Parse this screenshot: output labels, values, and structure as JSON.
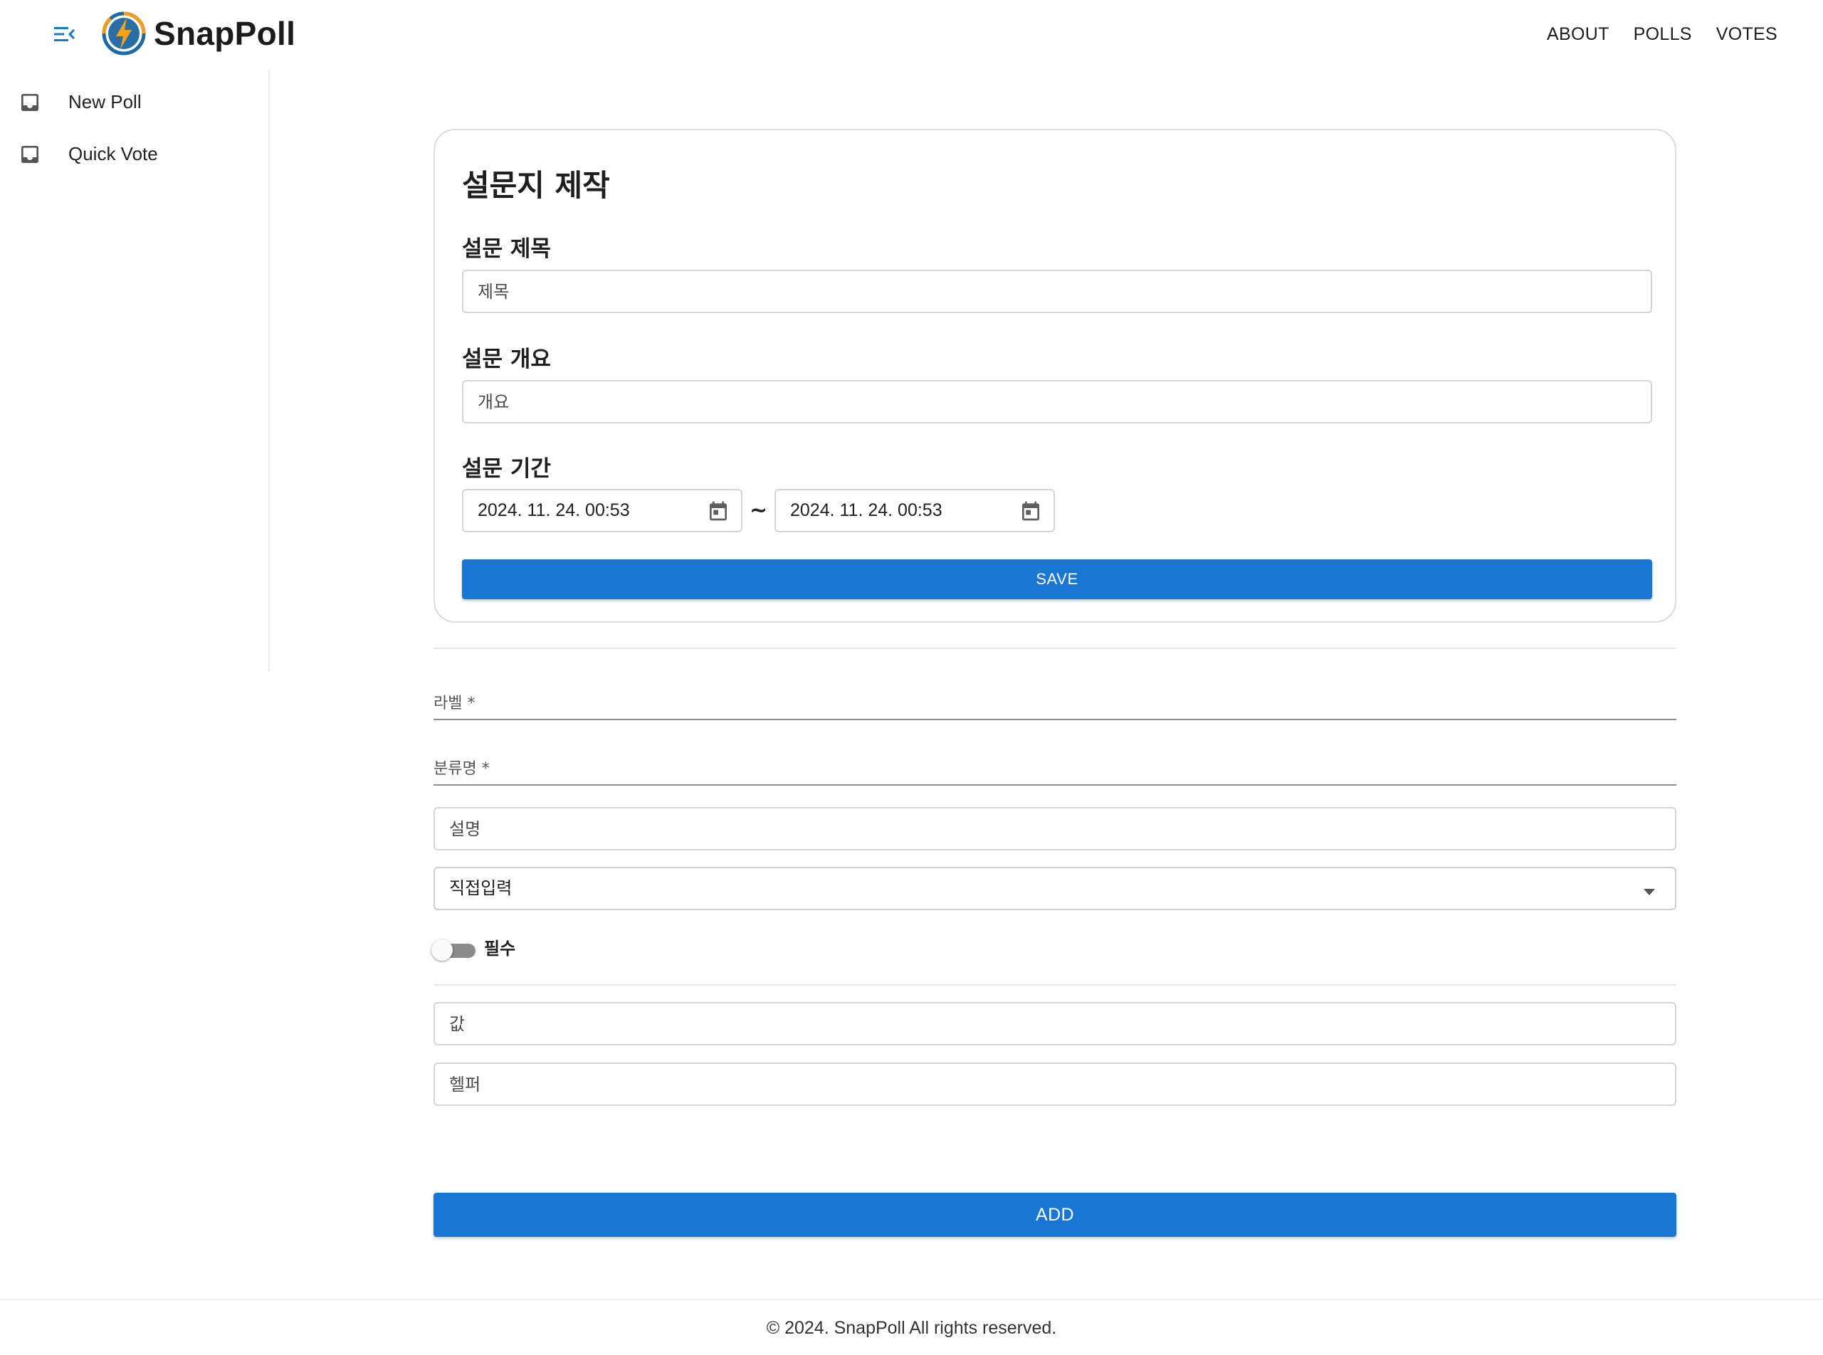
{
  "brand": {
    "name": "SnapPoll",
    "logo_icon": "bolt-logo-icon"
  },
  "colors": {
    "primary": "#1976d2",
    "logo_orange": "#f39c1f",
    "logo_blue": "#1e6aa8"
  },
  "topnav": {
    "items": [
      "ABOUT",
      "POLLS",
      "VOTES"
    ]
  },
  "sidebar": {
    "items": [
      {
        "label": "New Poll",
        "icon": "inbox-icon"
      },
      {
        "label": "Quick Vote",
        "icon": "inbox-icon"
      }
    ]
  },
  "poll_form": {
    "title": "설문지 제작",
    "subject_label": "설문 제목",
    "subject_placeholder": "제목",
    "overview_label": "설문 개요",
    "overview_placeholder": "개요",
    "period_label": "설문 기간",
    "start_date": "2024. 11. 24. 00:53",
    "separator": "~",
    "end_date": "2024. 11. 24. 00:53",
    "save_label": "SAVE"
  },
  "question_form": {
    "label_field": "라벨 *",
    "category_field": "분류명 *",
    "description_placeholder": "설명",
    "input_type_selected": "직접입력",
    "required_label": "필수",
    "required_on": false,
    "value_placeholder": "값",
    "helper_placeholder": "헬퍼",
    "add_label": "ADD"
  },
  "footer": {
    "text": "© 2024. SnapPoll All rights reserved."
  }
}
